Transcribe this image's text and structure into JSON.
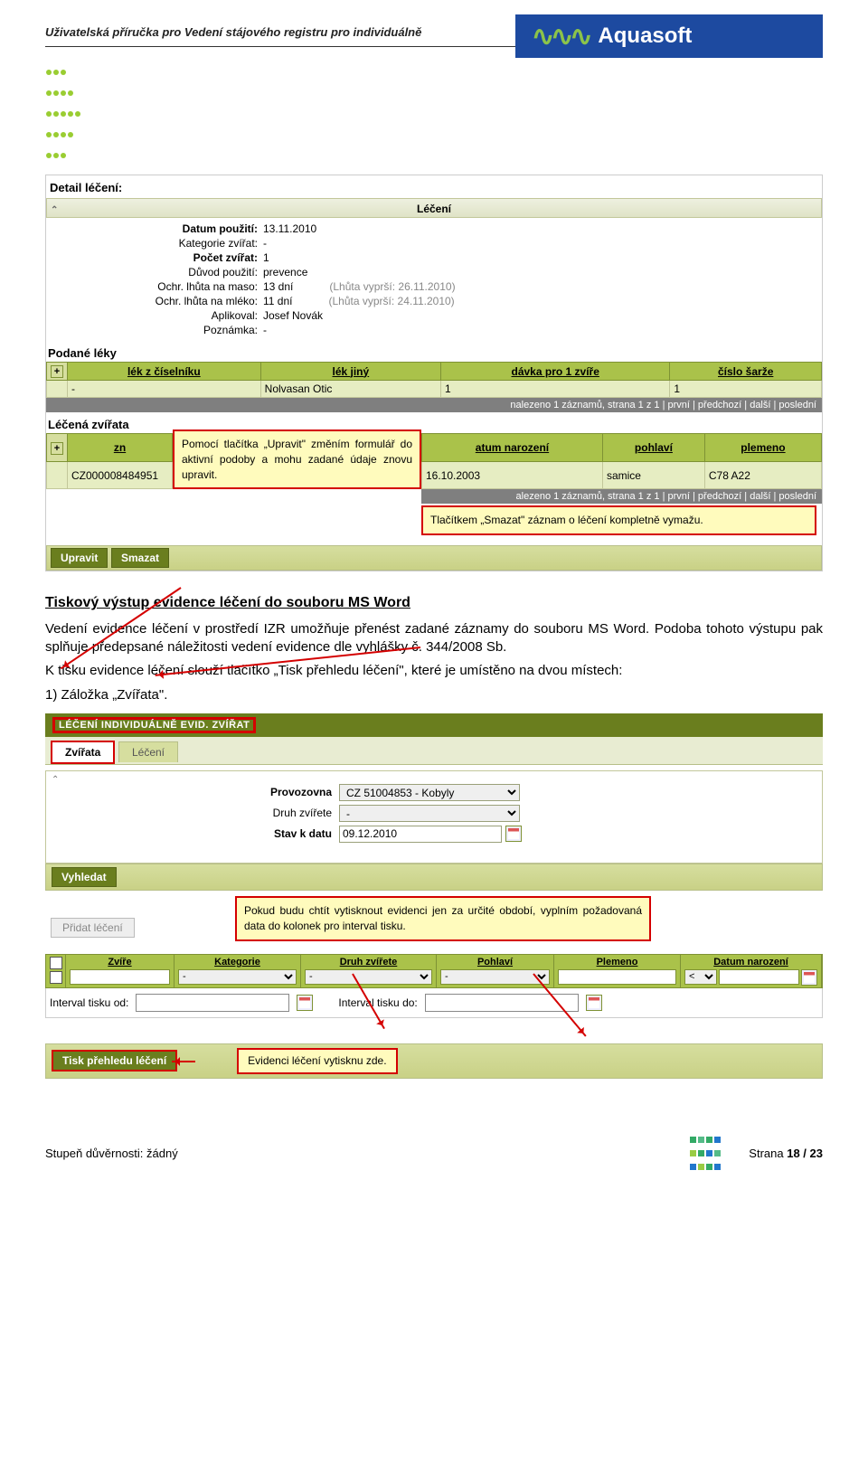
{
  "header": {
    "doc_title": "Uživatelská příručka pro Vedení stájového registru pro individuálně",
    "brand": "Aquasoft"
  },
  "detail": {
    "heading": "Detail léčení:",
    "section_title": "Léčení",
    "rows": {
      "datum_pouziti_k": "Datum použití:",
      "datum_pouziti_v": "13.11.2010",
      "kategorie_k": "Kategorie zvířat:",
      "kategorie_v": "-",
      "pocet_k": "Počet zvířat:",
      "pocet_v": "1",
      "duvod_k": "Důvod použití:",
      "duvod_v": "prevence",
      "lhuta_maso_k": "Ochr. lhůta na maso:",
      "lhuta_maso_v": "13 dní",
      "lhuta_maso_hint": "(Lhůta vyprší: 26.11.2010)",
      "lhuta_mleko_k": "Ochr. lhůta na mléko:",
      "lhuta_mleko_v": "11 dní",
      "lhuta_mleko_hint": "(Lhůta vyprší: 24.11.2010)",
      "aplikoval_k": "Aplikoval:",
      "aplikoval_v": "Josef Novák",
      "poznamka_k": "Poznámka:",
      "poznamka_v": "-"
    },
    "leky": {
      "title": "Podané léky",
      "cols": [
        "lék z číselníku",
        "lék jiný",
        "dávka pro 1 zvíře",
        "číslo šarže"
      ],
      "row": [
        "-",
        "Nolvasan Otic",
        "1",
        "1"
      ],
      "pager": "nalezeno 1 záznamů, strana 1 z 1 | první | předchozí | další | poslední"
    },
    "zvirata": {
      "title": "Léčená zvířata",
      "cols_partial": [
        "zn",
        "atum narození",
        "pohlaví",
        "plemeno"
      ],
      "row_id": "CZ000008484951",
      "row_date": "16.10.2003",
      "row_sex": "samice",
      "row_breed": "C78 A22",
      "pager": "alezeno 1 záznamů, strana 1 z 1 | první | předchozí | další | poslední"
    },
    "callout_edit": "Pomocí tlačítka „Upravit\" změním formulář do aktivní podoby a mohu zadané údaje znovu upravit.",
    "callout_delete": "Tlačítkem „Smazat\" záznam o léčení kompletně vymažu.",
    "btn_edit": "Upravit",
    "btn_delete": "Smazat"
  },
  "body": {
    "h3": "Tiskový výstup evidence léčení do souboru MS Word",
    "p1": "Vedení evidence léčení v prostředí IZR umožňuje přenést zadané záznamy do souboru MS Word. Podoba tohoto výstupu pak splňuje předepsané náležitosti vedení evidence dle vyhlášky č. 344/2008 Sb.",
    "p2": "K tisku evidence léčení slouží tlačítko „Tisk přehledu léčení\", které je umístěno na dvou místech:",
    "li1": "1)  Záložka „Zvířata\"."
  },
  "shot2": {
    "titlebar": "LÉČENÍ INDIVIDUÁLNĚ EVID. ZVÍŘAT",
    "tab_zvirata": "Zvířata",
    "tab_leceni": "Léčení",
    "provozovna_k": "Provozovna",
    "provozovna_v": "CZ 51004853 - Kobyly",
    "druh_k": "Druh zvířete",
    "druh_v": "-",
    "stav_k": "Stav k datu",
    "stav_v": "09.12.2010",
    "btn_search": "Vyhledat",
    "btn_add": "Přidat léčení",
    "filter_cols": [
      "Zvíře",
      "Kategorie",
      "Druh zvířete",
      "Pohlaví",
      "Plemeno",
      "Datum narození"
    ],
    "interval_od_k": "Interval tisku od:",
    "interval_do_k": "Interval tisku do:",
    "btn_print": "Tisk přehledu léčení",
    "callout_period": "Pokud budu chtít vytisknout evidenci jen za určité období, vyplním požadovaná data do kolonek pro interval tisku.",
    "callout_print": "Evidenci léčení vytisknu zde."
  },
  "footer": {
    "left": "Stupeň důvěrnosti: žádný",
    "right_label": "Strana",
    "right_page": "18 / 23"
  }
}
